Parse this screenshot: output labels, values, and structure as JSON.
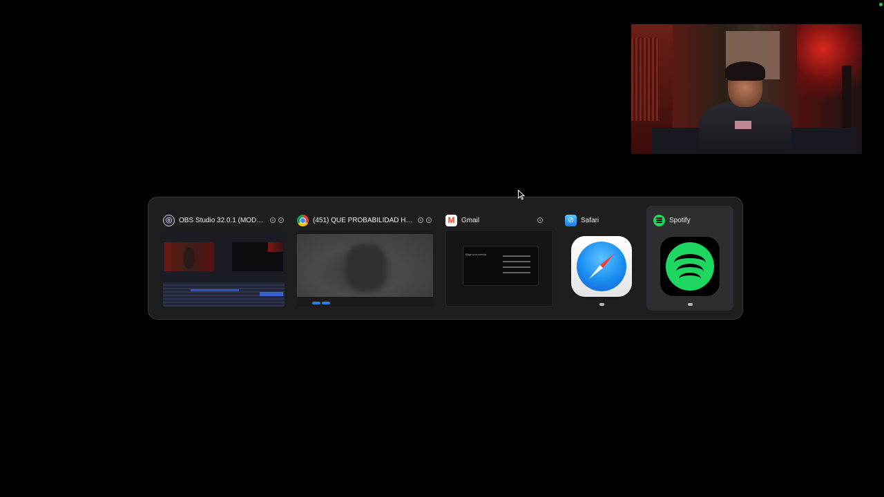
{
  "switcher": {
    "apps": [
      {
        "name": "OBS Studio 32.0.1 (MODO S...",
        "icon": "obs-icon",
        "has_window_controls": true
      },
      {
        "name": "(451) QUE PROBABILIDAD HAY/...",
        "icon": "chrome-icon",
        "has_window_controls": true
      },
      {
        "name": "Gmail",
        "icon": "gmail-icon",
        "has_window_controls": true
      },
      {
        "name": "Safari",
        "icon": "safari-icon",
        "has_window_controls": false
      },
      {
        "name": "Spotify",
        "icon": "spotify-icon",
        "has_window_controls": false
      }
    ],
    "selected": "Spotify"
  },
  "gmail_thumbnail": {
    "dialog_title": "Elige una cuenta"
  },
  "colors": {
    "background": "#000000",
    "switcher_bg": "#1e1e1f",
    "selected_bg": "#2e2e30",
    "spotify_green": "#1ed760",
    "status_dot": "#2ecc40"
  }
}
